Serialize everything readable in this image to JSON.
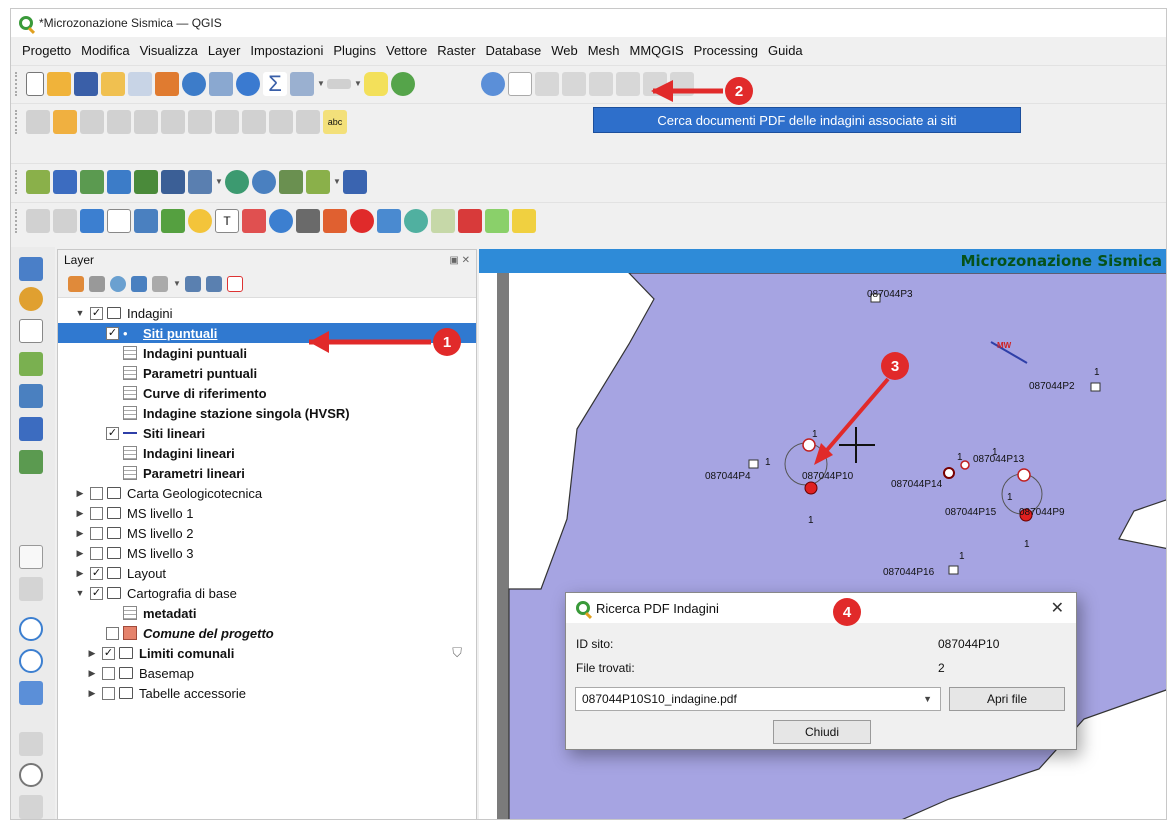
{
  "window": {
    "title": "*Microzonazione Sismica — QGIS"
  },
  "menu": [
    "Progetto",
    "Modifica",
    "Visualizza",
    "Layer",
    "Impostazioni",
    "Plugins",
    "Vettore",
    "Raster",
    "Database",
    "Web",
    "Mesh",
    "MMQGIS",
    "Processing",
    "Guida"
  ],
  "tooltip": "Cerca documenti PDF delle indagini associate ai siti",
  "layer_panel": {
    "title": "Layer",
    "items": [
      {
        "label": "Indagini",
        "level": 0,
        "checked": true,
        "expanded": true,
        "kind": "group"
      },
      {
        "label": "Siti puntuali",
        "level": 1,
        "checked": true,
        "kind": "point",
        "selected": true,
        "bold": true
      },
      {
        "label": "Indagini puntuali",
        "level": 1,
        "kind": "table",
        "bold": true
      },
      {
        "label": "Parametri puntuali",
        "level": 1,
        "kind": "table",
        "bold": true
      },
      {
        "label": "Curve di riferimento",
        "level": 1,
        "kind": "table",
        "bold": true
      },
      {
        "label": "Indagine stazione singola (HVSR)",
        "level": 1,
        "kind": "table",
        "bold": true
      },
      {
        "label": "Siti lineari",
        "level": 1,
        "checked": true,
        "kind": "line",
        "bold": true
      },
      {
        "label": "Indagini lineari",
        "level": 1,
        "kind": "table",
        "bold": true
      },
      {
        "label": "Parametri lineari",
        "level": 1,
        "kind": "table",
        "bold": true
      },
      {
        "label": "Carta Geologicotecnica",
        "level": 0,
        "checked": false,
        "expanded": false,
        "kind": "group"
      },
      {
        "label": "MS livello 1",
        "level": 0,
        "checked": false,
        "expanded": false,
        "kind": "group"
      },
      {
        "label": "MS livello 2",
        "level": 0,
        "checked": false,
        "expanded": false,
        "kind": "group"
      },
      {
        "label": "MS livello 3",
        "level": 0,
        "checked": false,
        "expanded": false,
        "kind": "group"
      },
      {
        "label": "Layout",
        "level": 0,
        "checked": true,
        "expanded": false,
        "kind": "group"
      },
      {
        "label": "Cartografia di base",
        "level": 0,
        "checked": true,
        "expanded": true,
        "kind": "group"
      },
      {
        "label": "metadati",
        "level": 1,
        "kind": "table",
        "bold": true
      },
      {
        "label": "Comune del progetto",
        "level": 1,
        "checked": false,
        "kind": "polygon",
        "italic": true,
        "bold": true
      },
      {
        "label": "Limiti comunali",
        "level": 1,
        "checked": true,
        "expanded": false,
        "kind": "group",
        "bold": true,
        "filter": true
      },
      {
        "label": "Basemap",
        "level": 1,
        "checked": false,
        "expanded": false,
        "kind": "group"
      },
      {
        "label": "Tabelle accessorie",
        "level": 1,
        "checked": false,
        "expanded": false,
        "kind": "group"
      }
    ]
  },
  "map": {
    "banner": "Microzonazione Sismica",
    "labels": [
      {
        "text": "087044P3"
      },
      {
        "text": "087044P2",
        "one": "1"
      },
      {
        "text": "087044P4",
        "one": "1"
      },
      {
        "text": "087044P10",
        "one": "1"
      },
      {
        "text": "087044P13",
        "one": "1"
      },
      {
        "text": "087044P14",
        "one": "1"
      },
      {
        "text": "087044P15",
        "one": "1"
      },
      {
        "text": "087044P9",
        "one": "1"
      },
      {
        "text": "087044P16",
        "one": "1"
      }
    ]
  },
  "dialog": {
    "title": "Ricerca PDF Indagini",
    "id_label": "ID sito:",
    "id_value": "087044P10",
    "files_label": "File trovati:",
    "files_value": "2",
    "selected_file": "087044P10S10_indagine.pdf",
    "open_button": "Apri file",
    "close_button": "Chiudi"
  },
  "callouts": [
    "1",
    "2",
    "3",
    "4"
  ],
  "colors": {
    "selection": "#3079d0",
    "map_polygon": "#a6a4e2",
    "callout": "#e12a2a",
    "banner": "#2e8bd8",
    "banner_text": "#06521a"
  }
}
